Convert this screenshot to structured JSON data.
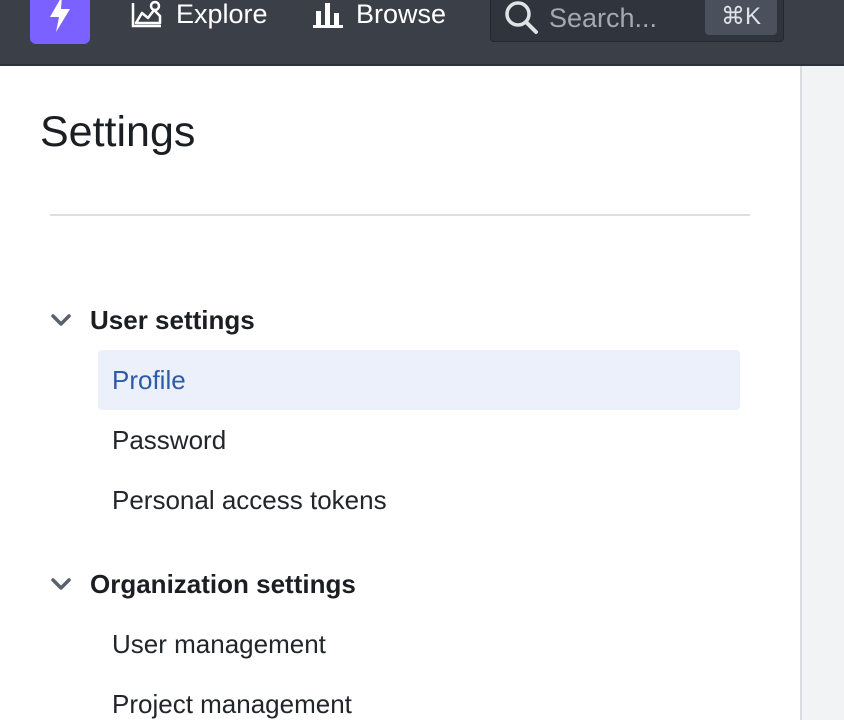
{
  "topbar": {
    "nav": [
      {
        "label": "Explore",
        "icon": "chart-area-icon"
      },
      {
        "label": "Browse",
        "icon": "bar-chart-icon"
      }
    ],
    "search": {
      "placeholder": "Search...",
      "shortcut": "⌘K"
    }
  },
  "page": {
    "title": "Settings"
  },
  "sections": [
    {
      "label": "User settings",
      "expanded": true,
      "items": [
        {
          "label": "Profile",
          "active": true
        },
        {
          "label": "Password",
          "active": false
        },
        {
          "label": "Personal access tokens",
          "active": false
        }
      ]
    },
    {
      "label": "Organization settings",
      "expanded": true,
      "items": [
        {
          "label": "User management",
          "active": false
        },
        {
          "label": "Project management",
          "active": false
        }
      ]
    }
  ],
  "colors": {
    "topbar": "#3a3f48",
    "brand": "#7b61ff",
    "active_bg": "#ebf0fb",
    "active_text": "#2f5aa8"
  }
}
